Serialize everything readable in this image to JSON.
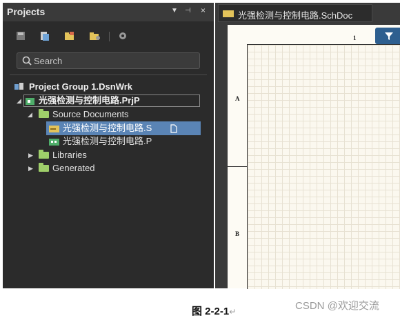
{
  "panel": {
    "title": "Projects",
    "controls": [
      "▼",
      "⊣",
      "×"
    ],
    "toolbar": [
      "save-icon",
      "new-document-icon",
      "open-project-icon",
      "folder-config-icon",
      "settings-icon"
    ],
    "search": {
      "placeholder": "Search",
      "value": ""
    },
    "tree": {
      "group": "Project Group 1.DsnWrk",
      "project": "光强检测与控制电路.PrjP",
      "folders": {
        "source": "Source Documents",
        "libraries": "Libraries",
        "generated": "Generated"
      },
      "files": {
        "schematic": "光强检测与控制电路.S",
        "pcb": "光强检测与控制电路.P"
      }
    }
  },
  "document": {
    "tab": "光强检测与控制电路.SchDoc",
    "zones": {
      "col1": "1",
      "rowA": "A",
      "rowB": "B"
    }
  },
  "caption": {
    "text": "图 2-2-1",
    "mark": "↵"
  },
  "watermark": "CSDN @欢迎交流",
  "colors": {
    "panel_bg": "#2b2b2b",
    "selection": "#5a84b5",
    "folder": "#9fcf6a",
    "sheet": "#fbf8ef",
    "filter": "#2e5f8f"
  }
}
